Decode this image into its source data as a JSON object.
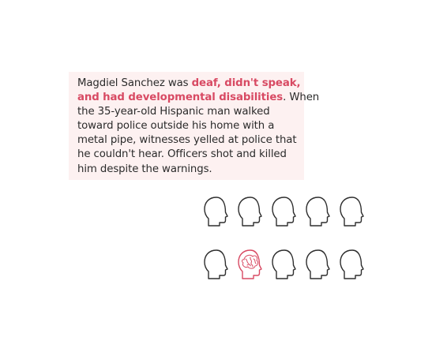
{
  "callout": {
    "lines": [
      {
        "parts": [
          {
            "text": "Magdiel Sanchez was ",
            "highlight": false
          },
          {
            "text": "deaf, didn't speak,",
            "highlight": true
          }
        ]
      },
      {
        "parts": [
          {
            "text": "and had developmental disabilities",
            "highlight": true
          },
          {
            "text": ".  When",
            "highlight": false
          }
        ]
      },
      {
        "parts": [
          {
            "text": "the 35-year-old Hispanic man walked",
            "highlight": false
          }
        ]
      },
      {
        "parts": [
          {
            "text": "toward police outside his home with a",
            "highlight": false
          }
        ]
      },
      {
        "parts": [
          {
            "text": "metal pipe, witnesses yelled at police that",
            "highlight": false
          }
        ]
      },
      {
        "parts": [
          {
            "text": "he couldn't hear.  Officers shot and killed",
            "highlight": false
          }
        ]
      },
      {
        "parts": [
          {
            "text": "him despite the warnings.",
            "highlight": false
          }
        ]
      }
    ]
  },
  "heads": {
    "total": 10,
    "per_row": 5,
    "highlighted_index": 6,
    "colors": {
      "default": "#2e2e2e",
      "highlight": "#d84a63"
    },
    "icon": "human-head-icon",
    "highlight_icon": "tangled-brain-head-icon"
  },
  "colors": {
    "highlight_text": "#d84a63",
    "callout_bg": "#fdf1f1"
  }
}
